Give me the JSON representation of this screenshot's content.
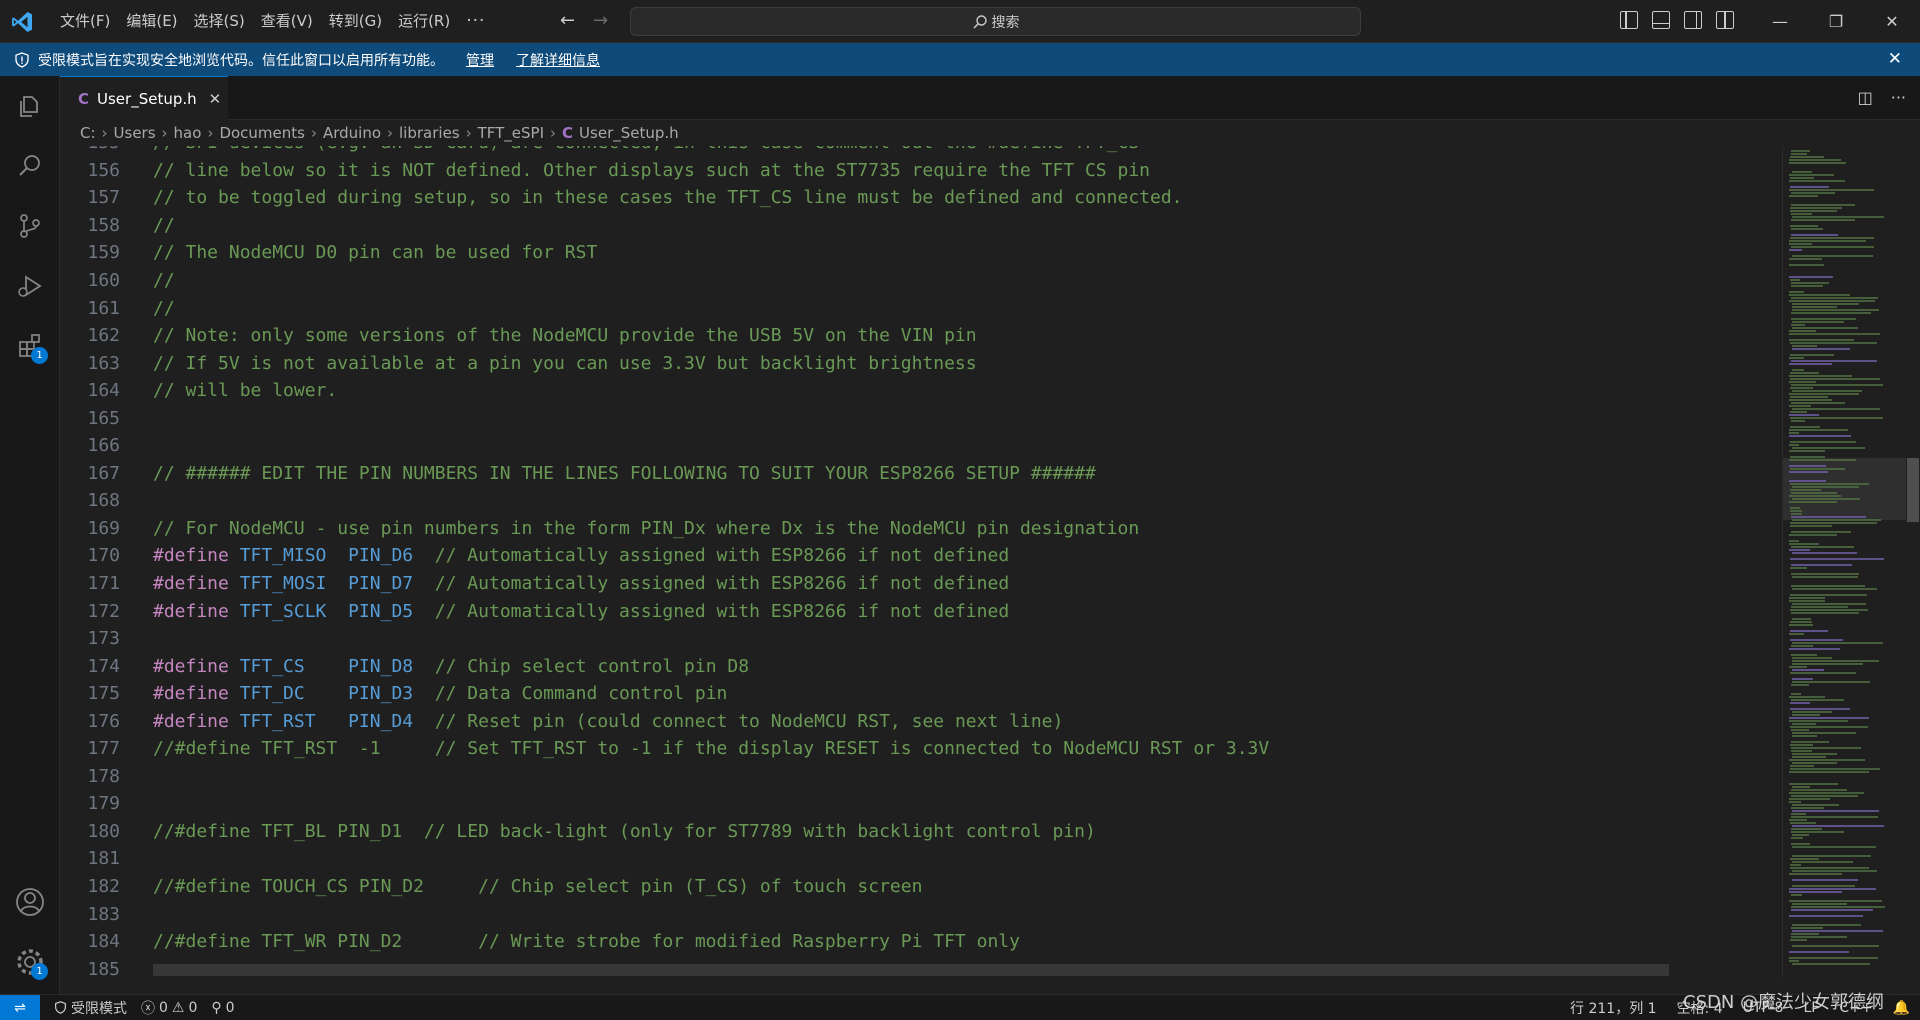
{
  "titlebar": {
    "menu": [
      "文件(F)",
      "编辑(E)",
      "选择(S)",
      "查看(V)",
      "转到(G)",
      "运行(R)"
    ],
    "more": "···",
    "search_label": "搜索"
  },
  "banner": {
    "message": "受限模式旨在实现安全地浏览代码。信任此窗口以启用所有功能。",
    "manage_link": "管理",
    "learn_more_link": "了解详细信息"
  },
  "activity": {
    "extensions_badge": "1",
    "settings_badge": "1"
  },
  "tab": {
    "icon_letter": "C",
    "filename": "User_Setup.h"
  },
  "breadcrumb": [
    "C:",
    "Users",
    "hao",
    "Documents",
    "Arduino",
    "libraries",
    "TFT_eSPI",
    "User_Setup.h"
  ],
  "editor": {
    "lines": [
      {
        "n": "155",
        "parts": [
          {
            "t": "// SPI devices (e.g. an SD Card) are connected, in this case comment out the #define TFT_CS",
            "c": "comment"
          }
        ]
      },
      {
        "n": "156",
        "parts": [
          {
            "t": "// line below so it is NOT defined. Other displays such at the ST7735 require the TFT CS pin",
            "c": "comment"
          }
        ]
      },
      {
        "n": "157",
        "parts": [
          {
            "t": "// to be toggled during setup, so in these cases the TFT_CS line must be defined and connected.",
            "c": "comment"
          }
        ]
      },
      {
        "n": "158",
        "parts": [
          {
            "t": "//",
            "c": "comment"
          }
        ]
      },
      {
        "n": "159",
        "parts": [
          {
            "t": "// The NodeMCU D0 pin can be used for RST",
            "c": "comment"
          }
        ]
      },
      {
        "n": "160",
        "parts": [
          {
            "t": "//",
            "c": "comment"
          }
        ]
      },
      {
        "n": "161",
        "parts": [
          {
            "t": "//",
            "c": "comment"
          }
        ]
      },
      {
        "n": "162",
        "parts": [
          {
            "t": "// Note: only some versions of the NodeMCU provide the USB 5V on the VIN pin",
            "c": "comment"
          }
        ]
      },
      {
        "n": "163",
        "parts": [
          {
            "t": "// If 5V is not available at a pin you can use 3.3V but backlight brightness",
            "c": "comment"
          }
        ]
      },
      {
        "n": "164",
        "parts": [
          {
            "t": "// will be lower.",
            "c": "comment"
          }
        ]
      },
      {
        "n": "165",
        "parts": []
      },
      {
        "n": "166",
        "parts": []
      },
      {
        "n": "167",
        "parts": [
          {
            "t": "// ###### EDIT THE PIN NUMBERS IN THE LINES FOLLOWING TO SUIT YOUR ESP8266 SETUP ######",
            "c": "comment"
          }
        ]
      },
      {
        "n": "168",
        "parts": []
      },
      {
        "n": "169",
        "parts": [
          {
            "t": "// For NodeMCU - use pin numbers in the form PIN_Dx where Dx is the NodeMCU pin designation",
            "c": "comment"
          }
        ]
      },
      {
        "n": "170",
        "parts": [
          {
            "t": "#define ",
            "c": "kw"
          },
          {
            "t": "TFT_MISO",
            "c": "mac"
          },
          {
            "t": "  ",
            "c": "txt"
          },
          {
            "t": "PIN_D6",
            "c": "mac"
          },
          {
            "t": "  // Automatically assigned with ESP8266 if not defined",
            "c": "comment"
          }
        ]
      },
      {
        "n": "171",
        "parts": [
          {
            "t": "#define ",
            "c": "kw"
          },
          {
            "t": "TFT_MOSI",
            "c": "mac"
          },
          {
            "t": "  ",
            "c": "txt"
          },
          {
            "t": "PIN_D7",
            "c": "mac"
          },
          {
            "t": "  // Automatically assigned with ESP8266 if not defined",
            "c": "comment"
          }
        ]
      },
      {
        "n": "172",
        "parts": [
          {
            "t": "#define ",
            "c": "kw"
          },
          {
            "t": "TFT_SCLK",
            "c": "mac"
          },
          {
            "t": "  ",
            "c": "txt"
          },
          {
            "t": "PIN_D5",
            "c": "mac"
          },
          {
            "t": "  // Automatically assigned with ESP8266 if not defined",
            "c": "comment"
          }
        ]
      },
      {
        "n": "173",
        "parts": []
      },
      {
        "n": "174",
        "parts": [
          {
            "t": "#define ",
            "c": "kw"
          },
          {
            "t": "TFT_CS",
            "c": "mac"
          },
          {
            "t": "    ",
            "c": "txt"
          },
          {
            "t": "PIN_D8",
            "c": "mac"
          },
          {
            "t": "  // Chip select control pin D8",
            "c": "comment"
          }
        ]
      },
      {
        "n": "175",
        "parts": [
          {
            "t": "#define ",
            "c": "kw"
          },
          {
            "t": "TFT_DC",
            "c": "mac"
          },
          {
            "t": "    ",
            "c": "txt"
          },
          {
            "t": "PIN_D3",
            "c": "mac"
          },
          {
            "t": "  // Data Command control pin",
            "c": "comment"
          }
        ]
      },
      {
        "n": "176",
        "parts": [
          {
            "t": "#define ",
            "c": "kw"
          },
          {
            "t": "TFT_RST",
            "c": "mac"
          },
          {
            "t": "   ",
            "c": "txt"
          },
          {
            "t": "PIN_D4",
            "c": "mac"
          },
          {
            "t": "  // Reset pin (could connect to NodeMCU RST, see next line)",
            "c": "comment"
          }
        ]
      },
      {
        "n": "177",
        "parts": [
          {
            "t": "//#define TFT_RST  -1     // Set TFT_RST to -1 if the display RESET is connected to NodeMCU RST or 3.3V",
            "c": "comment"
          }
        ]
      },
      {
        "n": "178",
        "parts": []
      },
      {
        "n": "179",
        "parts": []
      },
      {
        "n": "180",
        "parts": [
          {
            "t": "//#define TFT_BL PIN_D1  // LED back-light (only for ST7789 with backlight control pin)",
            "c": "comment"
          }
        ]
      },
      {
        "n": "181",
        "parts": []
      },
      {
        "n": "182",
        "parts": [
          {
            "t": "//#define TOUCH_CS PIN_D2     // Chip select pin (T_CS) of touch screen",
            "c": "comment"
          }
        ]
      },
      {
        "n": "183",
        "parts": []
      },
      {
        "n": "184",
        "parts": [
          {
            "t": "//#define TFT_WR PIN_D2       // Write strobe for modified Raspberry Pi TFT only",
            "c": "comment"
          }
        ]
      },
      {
        "n": "185",
        "parts": []
      }
    ]
  },
  "statusbar": {
    "restricted_mode": "受限模式",
    "errors": "0",
    "warnings": "0",
    "ports": "0",
    "cursor_position": "行 211，列 1",
    "spaces": "空格: 4",
    "encoding": "UTF-8",
    "eol": "LF",
    "language": "C++",
    "watermark": "CSDN @魔法少女郭德纲"
  },
  "colors": {
    "accent": "#0078d4",
    "banner": "#0e4a7a",
    "comment": "#6a9955",
    "keyword": "#c586c0",
    "macro": "#569cd6"
  }
}
